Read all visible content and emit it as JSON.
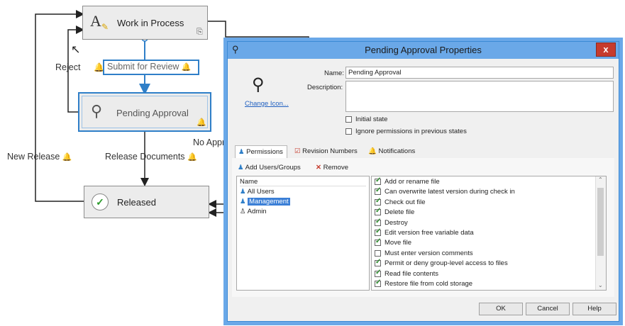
{
  "workflow": {
    "states": {
      "work_in_process": "Work in Process",
      "pending_approval": "Pending Approval",
      "released": "Released"
    },
    "transitions": {
      "submit_for_review": "Submit for Review",
      "reject": "Reject",
      "new_release": "New Release",
      "release_documents": "Release Documents",
      "no_approval": "No Appr"
    }
  },
  "dialog": {
    "title": "Pending Approval Properties",
    "close": "x",
    "change_icon": "Change Icon...",
    "name_label": "Name:",
    "name_value": "Pending Approval",
    "description_label": "Description:",
    "initial_state": "Initial state",
    "ignore_permissions": "Ignore permissions in previous states",
    "tabs": [
      "Permissions",
      "Revision Numbers",
      "Notifications"
    ],
    "add_users": "Add Users/Groups",
    "remove": "Remove",
    "users_header": "Name",
    "users": [
      "All Users",
      "Management",
      "Admin"
    ],
    "permissions": [
      {
        "label": "Add or rename file",
        "checked": true
      },
      {
        "label": "Can overwrite latest version during check in",
        "checked": true
      },
      {
        "label": "Check out file",
        "checked": true
      },
      {
        "label": "Delete file",
        "checked": true
      },
      {
        "label": "Destroy",
        "checked": true
      },
      {
        "label": "Edit version free variable data",
        "checked": true
      },
      {
        "label": "Move file",
        "checked": true
      },
      {
        "label": "Must enter version comments",
        "checked": false
      },
      {
        "label": "Permit or deny group-level access to files",
        "checked": true
      },
      {
        "label": "Read file contents",
        "checked": true
      },
      {
        "label": "Restore file from cold storage",
        "checked": true
      }
    ],
    "buttons": {
      "ok": "OK",
      "cancel": "Cancel",
      "help": "Help"
    }
  },
  "colors": {
    "accent": "#2f7fc8",
    "titlebar": "#6aa8e8",
    "close": "#c63b2d",
    "bell": "#d9a400"
  }
}
